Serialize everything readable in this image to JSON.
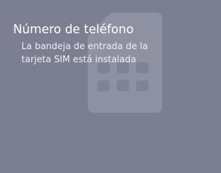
{
  "tile": {
    "title": "Número de teléfono",
    "description": "La bandeja de entrada de la tarjeta SIM está instalada",
    "icon": "sim-card-icon"
  },
  "colors": {
    "background": "#7b7f91",
    "title": "#ffffff",
    "description": "#eef0f5",
    "icon": "#8e91a2"
  }
}
